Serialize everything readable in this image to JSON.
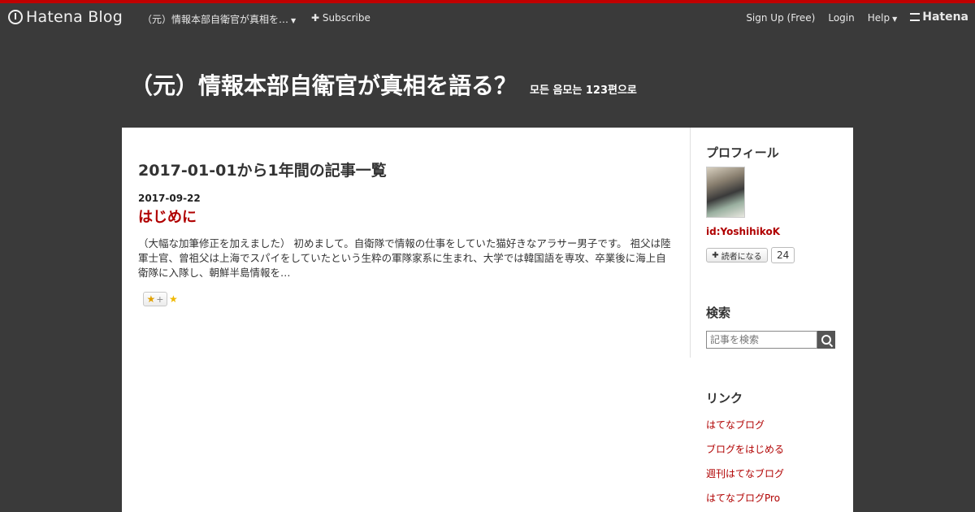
{
  "topbar": {
    "logo_text": "Hatena Blog",
    "blog_selector": "（元）情報本部自衛官が真相を…",
    "subscribe": "Subscribe",
    "signup": "Sign Up (Free)",
    "login": "Login",
    "help": "Help",
    "brand": "Hatena"
  },
  "blog": {
    "title": "（元）情報本部自衛官が真相を語る？",
    "description": "모든 음모는 123편으로"
  },
  "archive": {
    "heading": "2017-01-01から1年間の記事一覧",
    "entries": [
      {
        "date": "2017-09-22",
        "title": "はじめに",
        "summary": "（大幅な加筆修正を加えました） 初めまして。自衛隊で情報の仕事をしていた猫好きなアラサー男子です。 祖父は陸軍士官、曾祖父は上海でスパイをしていたという生粋の軍隊家系に生まれ、大学では韓国語を専攻、卒業後に海上自衛隊に入隊し、朝鮮半島情報を…"
      }
    ]
  },
  "sidebar": {
    "profile_title": "プロフィール",
    "profile_id": "id:YoshihikoK",
    "reader_button": "読者になる",
    "reader_count": "24",
    "search_title": "検索",
    "search_placeholder": "記事を検索",
    "links_title": "リンク",
    "links": [
      "はてなブログ",
      "ブログをはじめる",
      "週刊はてなブログ",
      "はてなブログPro"
    ]
  },
  "colors": {
    "accent": "#b00000",
    "background": "#3a3a3a",
    "topline": "#c00000"
  }
}
